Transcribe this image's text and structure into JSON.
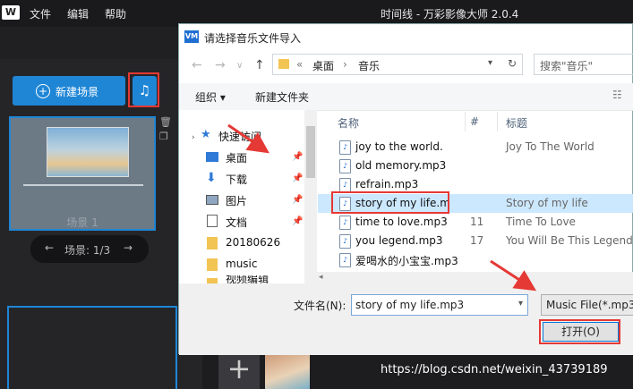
{
  "app": {
    "logo": "W",
    "menu": [
      "文件",
      "编辑",
      "帮助"
    ],
    "title": "时间线 - 万彩影像大师 2.0.4"
  },
  "left_panel": {
    "new_scene_label": "新建场景",
    "scene_label": "场景 1",
    "pager_label": "场景: 1/3",
    "prev_icon": "arrow-left-icon",
    "next_icon": "arrow-right-icon"
  },
  "bottom": {
    "add_label": "+",
    "watermark": "https://blog.csdn.net/weixin_43739189"
  },
  "dialog": {
    "title_icon": "VM",
    "title": "请选择音乐文件导入",
    "breadcrumb": {
      "chevron": "«",
      "part1": "桌面",
      "separator": "›",
      "part2": "音乐"
    },
    "search_placeholder": "搜索\"音乐\"",
    "toolbar": {
      "organize": "组织 ▾",
      "new_folder": "新建文件夹"
    },
    "nav": [
      {
        "label": "快速访问",
        "icon": "star-icon",
        "pinned": false
      },
      {
        "label": "桌面",
        "icon": "desktop-icon",
        "pinned": true
      },
      {
        "label": "下载",
        "icon": "download-icon",
        "pinned": true
      },
      {
        "label": "图片",
        "icon": "pictures-icon",
        "pinned": true
      },
      {
        "label": "文档",
        "icon": "documents-icon",
        "pinned": true
      },
      {
        "label": "20180626",
        "icon": "folder-icon",
        "pinned": false
      },
      {
        "label": "music",
        "icon": "folder-icon",
        "pinned": false
      },
      {
        "label": "视频编辑",
        "icon": "folder-icon",
        "pinned": false
      }
    ],
    "columns": {
      "name": "名称",
      "number": "#",
      "title": "标题"
    },
    "files": [
      {
        "name": "joy to the world.",
        "number": "",
        "title": "Joy To The World",
        "selected": false
      },
      {
        "name": "old memory.mp3",
        "number": "",
        "title": "",
        "selected": false
      },
      {
        "name": "refrain.mp3",
        "number": "",
        "title": "",
        "selected": false
      },
      {
        "name": "story of my life.m",
        "number": "",
        "title": "Story of my life",
        "selected": true
      },
      {
        "name": "time to love.mp3",
        "number": "11",
        "title": "Time To Love",
        "selected": false
      },
      {
        "name": "you legend.mp3",
        "number": "17",
        "title": "You Will Be This Legend",
        "selected": false
      },
      {
        "name": "爱喝水的小宝宝.mp3",
        "number": "",
        "title": "",
        "selected": false
      }
    ],
    "filename_label": "文件名(N):",
    "filename_value": "story of my life.mp3",
    "filter_value": "Music File(*.mp3;*",
    "open_label": "打开(O)"
  },
  "colors": {
    "accent": "#1f86d6",
    "highlight": "#e53935",
    "selection": "#cce8ff"
  }
}
